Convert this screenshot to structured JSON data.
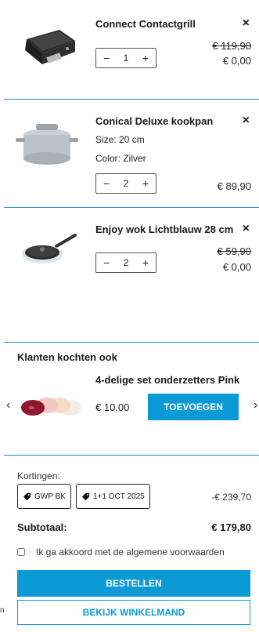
{
  "items": [
    {
      "name": "Connect Contactgrill",
      "qty": "1",
      "old_price": "€ 119,90",
      "price": "€ 0,00",
      "attrs": []
    },
    {
      "name": "Conical Deluxe kookpan",
      "qty": "2",
      "old_price": "",
      "price": "€ 89,90",
      "attrs": [
        "Size: 20 cm",
        "Color: Zilver"
      ]
    },
    {
      "name": "Enjoy wok Lichtblauw 28 cm",
      "qty": "2",
      "old_price": "€ 59,90",
      "price": "€ 0,00",
      "attrs": []
    }
  ],
  "controls": {
    "close": "×",
    "minus": "−",
    "plus": "+"
  },
  "upsell": {
    "title": "Klanten kochten ook",
    "product_name": "4-delige set onderzetters Pink",
    "price": "€ 10,00",
    "add_label": "TOEVOEGEN",
    "prev": "‹",
    "next": "›"
  },
  "discounts": {
    "label": "Kortingen:",
    "tags": [
      "GWP BK",
      "1+1 OCT 2025"
    ],
    "amount": "-€ 239,70"
  },
  "subtotal": {
    "label": "Subtotaal:",
    "value": "€ 179,80"
  },
  "terms_label": "Ik ga akkoord met de algemene voorwaarden",
  "buttons": {
    "order": "BESTELLEN",
    "view_cart": "BEKIJK WINKELMAND"
  },
  "edge_text": "n",
  "colors": {
    "accent": "#0b9ad6",
    "divider": "#1a8fc2"
  }
}
